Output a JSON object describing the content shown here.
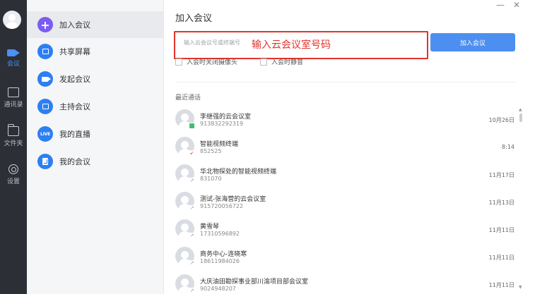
{
  "window": {
    "minimize": "—",
    "close": "✕"
  },
  "rail": {
    "items": [
      {
        "label": "会议",
        "icon": "video-icon"
      },
      {
        "label": "通讯录",
        "icon": "contacts-icon"
      },
      {
        "label": "文件夹",
        "icon": "folder-icon"
      },
      {
        "label": "设置",
        "icon": "settings-icon"
      }
    ]
  },
  "menu": {
    "items": [
      {
        "label": "加入会议",
        "icon": "+"
      },
      {
        "label": "共享屏幕",
        "icon": "share-screen-icon"
      },
      {
        "label": "发起会议",
        "icon": "camera-icon"
      },
      {
        "label": "主持会议",
        "icon": "host-icon"
      },
      {
        "label": "我的直播",
        "icon": "LIVE"
      },
      {
        "label": "我的会议",
        "icon": "my-meeting-icon"
      }
    ]
  },
  "main": {
    "title": "加入会议",
    "id_placeholder": "输入云会议号或终端号",
    "annotation": "输入云会议室号码",
    "join_label": "加入会议",
    "option_camera": "入会时关闭摄像头",
    "option_mute": "入会时静音",
    "recent_title": "最近通话"
  },
  "recent": [
    {
      "name": "李继强的云会议室",
      "number": "913832292319",
      "date": "10月26日"
    },
    {
      "name": "智能视频终端",
      "number": "852525",
      "date": "8:14"
    },
    {
      "name": "华北物探处的智能视频终端",
      "number": "831070",
      "date": "11月17日"
    },
    {
      "name": "测试-张海营的云会议室",
      "number": "915720056722",
      "date": "11月13日"
    },
    {
      "name": "黄雪琴",
      "number": "17310596892",
      "date": "11月11日"
    },
    {
      "name": "商务中心-连晓寒",
      "number": "18611984026",
      "date": "11月11日"
    },
    {
      "name": "大庆油田勘探事业部川渝项目部会议室",
      "number": "9024948207",
      "date": "11月11日"
    }
  ],
  "colors": {
    "accent": "#4c8ff0",
    "highlight": "#e0342c",
    "rail": "#2c2f36"
  }
}
